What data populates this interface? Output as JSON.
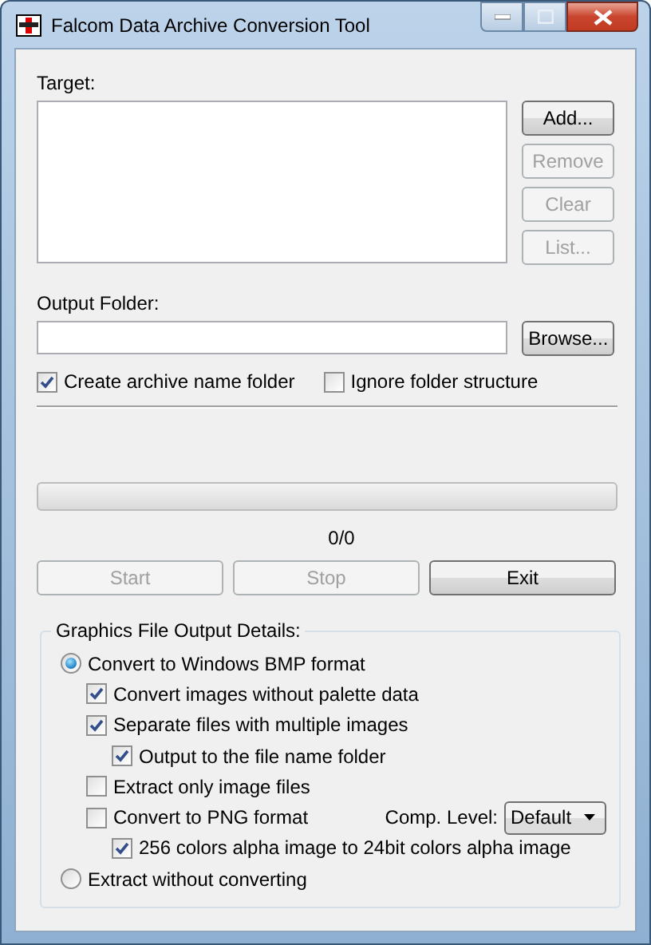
{
  "window": {
    "title": "Falcom Data Archive Conversion Tool"
  },
  "target": {
    "label": "Target:"
  },
  "target_buttons": [
    {
      "label": "Add...",
      "disabled": false
    },
    {
      "label": "Remove",
      "disabled": true
    },
    {
      "label": "Clear",
      "disabled": true
    },
    {
      "label": "List...",
      "disabled": true
    }
  ],
  "output_folder": {
    "label": "Output Folder:",
    "button": "Browse..."
  },
  "folder_options": [
    {
      "label": "Create archive name folder",
      "checked": true
    },
    {
      "label": "Ignore folder structure",
      "checked": false
    }
  ],
  "progress": {
    "reading": "0/0"
  },
  "actions": [
    {
      "label": "Start",
      "disabled": true
    },
    {
      "label": "Stop",
      "disabled": true
    },
    {
      "label": "Exit",
      "disabled": false
    }
  ],
  "graphics": {
    "title": "Graphics File Output Details:",
    "options": [
      {
        "kind": "radio",
        "label": "Convert to Windows BMP format",
        "selected": true,
        "children": [
          {
            "kind": "checkbox",
            "label": "Convert images without palette data",
            "checked": true
          },
          {
            "kind": "checkbox",
            "label": "Separate files with multiple images",
            "checked": true,
            "children": [
              {
                "kind": "checkbox",
                "label": "Output to the file name folder",
                "checked": true
              }
            ]
          },
          {
            "kind": "checkbox",
            "label": "Extract only image files",
            "checked": false
          },
          {
            "kind": "checkbox",
            "label": "Convert to PNG format",
            "checked": false,
            "combo": {
              "label": "Comp. Level:",
              "value": "Default"
            },
            "children": [
              {
                "kind": "checkbox",
                "label": "256 colors alpha image to 24bit colors alpha image",
                "checked": true
              }
            ]
          }
        ]
      },
      {
        "kind": "radio",
        "label": "Extract without converting",
        "selected": false
      }
    ]
  }
}
